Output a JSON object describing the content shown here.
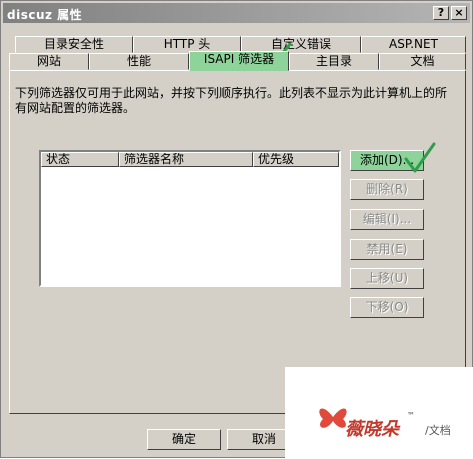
{
  "window": {
    "title": "discuz 属性",
    "help_glyph": "?",
    "close_glyph": "×"
  },
  "tabs_back": [
    "目录安全性",
    "HTTP 头",
    "自定义错误",
    "ASP.NET"
  ],
  "tabs_front": [
    "网站",
    "性能",
    "ISAPI 筛选器",
    "主目录",
    "文档"
  ],
  "active_tab": "ISAPI 筛选器",
  "description": "下列筛选器仅可用于此网站，并按下列顺序执行。此列表不显示为此计算机上的所有网站配置的筛选器。",
  "list": {
    "columns": [
      "状态",
      "筛选器名称",
      "优先级"
    ],
    "rows": []
  },
  "side_buttons": {
    "add": "添加(D)...",
    "remove": "删除(R)",
    "edit": "编辑(I)...",
    "disable": "禁用(E)",
    "move_up": "上移(U)",
    "move_down": "下移(O)"
  },
  "bottom_buttons": {
    "ok": "确定",
    "cancel": "取消"
  },
  "watermark": {
    "brand": "薇晓朵",
    "trademark": "™",
    "suffix": "/文档"
  },
  "colors": {
    "highlight": "#8ed39a",
    "check": "#2e9e4a",
    "face": "#d4d0c8"
  }
}
